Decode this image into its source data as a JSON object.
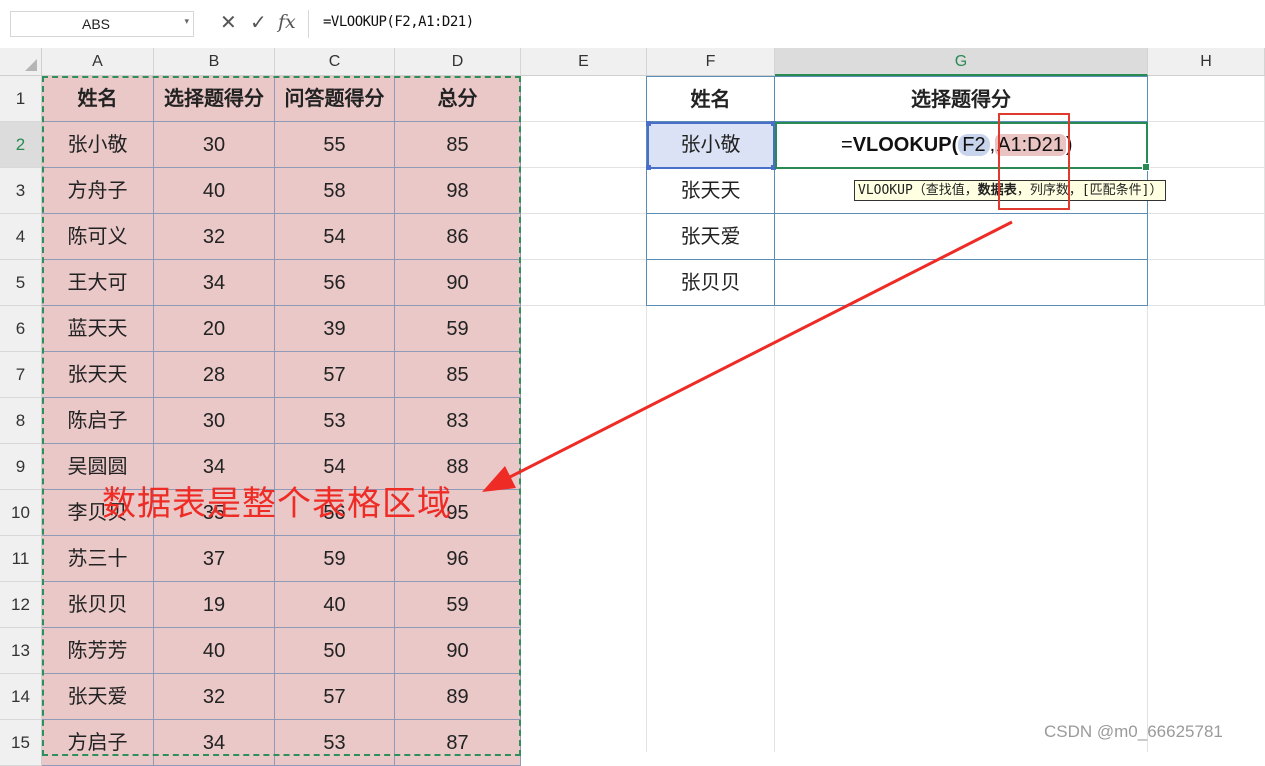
{
  "formula_bar": {
    "name_box": "ABS",
    "cancel_icon": "✕",
    "confirm_icon": "✓",
    "fx_icon": "fx",
    "formula": "=VLOOKUP(F2,A1:D21)"
  },
  "columns": [
    "A",
    "B",
    "C",
    "D",
    "E",
    "F",
    "G",
    "H"
  ],
  "rows": [
    "1",
    "2",
    "3",
    "4",
    "5",
    "6",
    "7",
    "8",
    "9",
    "10",
    "11",
    "12",
    "13",
    "14",
    "15"
  ],
  "table": {
    "headers": [
      "姓名",
      "选择题得分",
      "问答题得分",
      "总分"
    ],
    "rows": [
      [
        "张小敬",
        "30",
        "55",
        "85"
      ],
      [
        "方舟子",
        "40",
        "58",
        "98"
      ],
      [
        "陈可义",
        "32",
        "54",
        "86"
      ],
      [
        "王大可",
        "34",
        "56",
        "90"
      ],
      [
        "蓝天天",
        "20",
        "39",
        "59"
      ],
      [
        "张天天",
        "28",
        "57",
        "85"
      ],
      [
        "陈启子",
        "30",
        "53",
        "83"
      ],
      [
        "吴圆圆",
        "34",
        "54",
        "88"
      ],
      [
        "李贝贝",
        "35",
        "56",
        "95"
      ],
      [
        "苏三十",
        "37",
        "59",
        "96"
      ],
      [
        "张贝贝",
        "19",
        "40",
        "59"
      ],
      [
        "陈芳芳",
        "40",
        "50",
        "90"
      ],
      [
        "张天爱",
        "32",
        "57",
        "89"
      ],
      [
        "方启子",
        "34",
        "53",
        "87"
      ]
    ]
  },
  "lookup": {
    "headers": [
      "姓名",
      "选择题得分"
    ],
    "names": [
      "张小敬",
      "张天天",
      "张天爱",
      "张贝贝"
    ]
  },
  "active_cell": {
    "eq": "=",
    "fn": "VLOOKUP(",
    "ref1": "F2",
    "comma": ",",
    "ref2": "A1:D21",
    "close": ")"
  },
  "tooltip": {
    "prefix": "VLOOKUP（查找值，",
    "bold": "数据表",
    "suffix": "，列序数，[匹配条件]）"
  },
  "annotation": "数据表是整个表格区域",
  "watermark": "CSDN @m0_66625781",
  "colors": {
    "data_fill": "#eac8c8",
    "active_green": "#2a8a53",
    "annotation_red": "#ee2b25",
    "selection_blue": "#4a6fc9"
  }
}
